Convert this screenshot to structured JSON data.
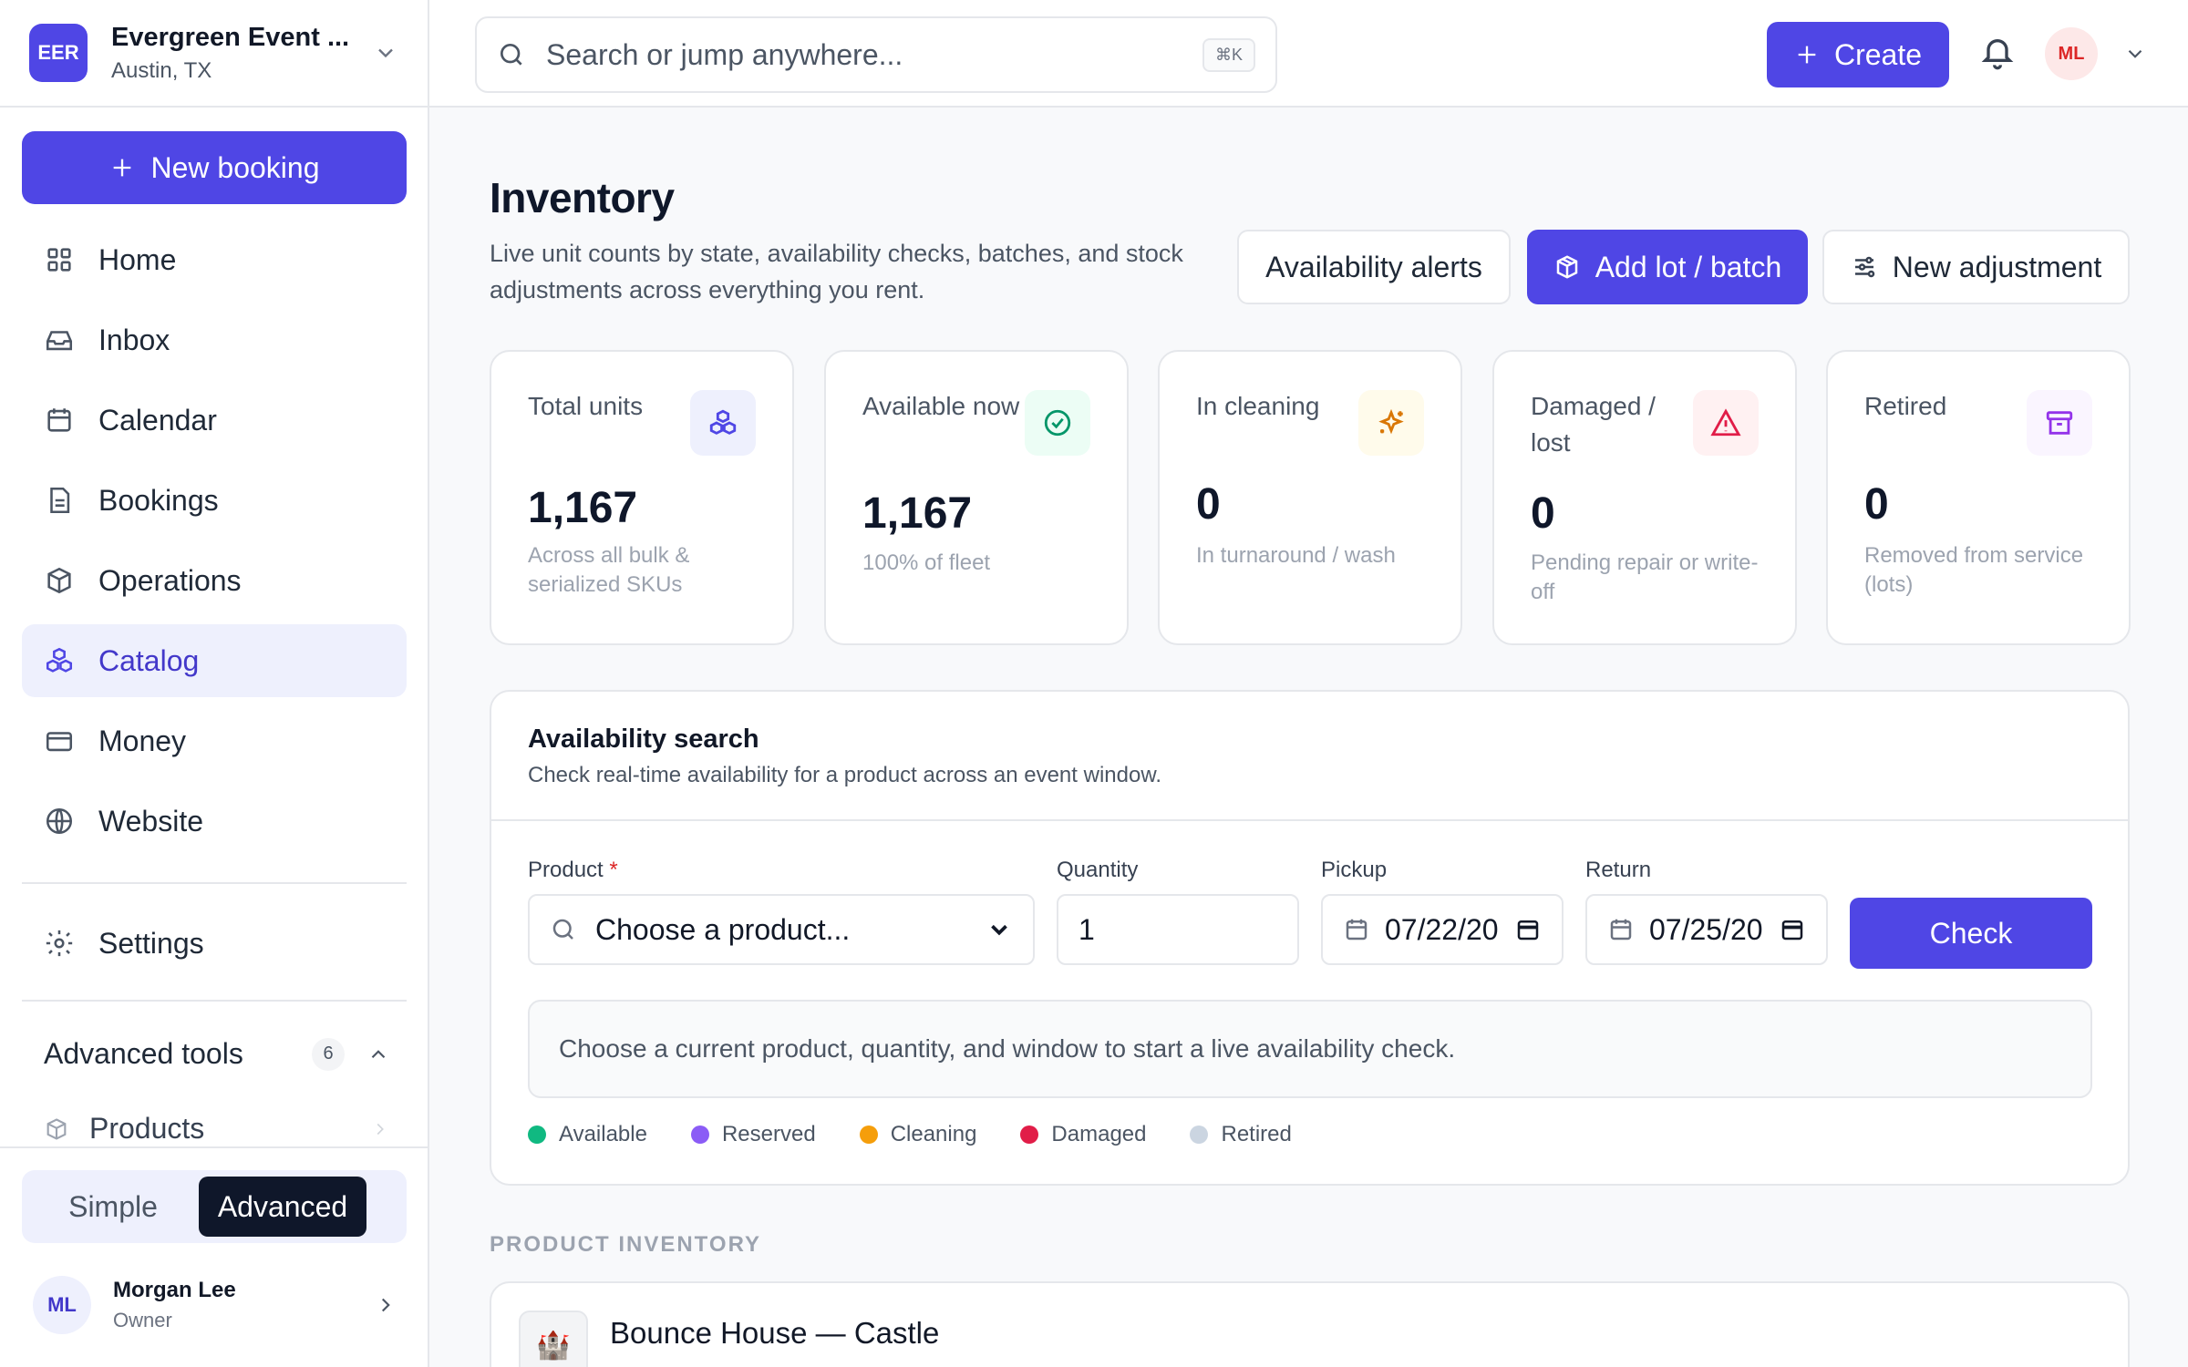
{
  "org": {
    "badge": "EER",
    "name": "Evergreen Event ...",
    "location": "Austin, TX"
  },
  "sidebar": {
    "new_booking": "New booking",
    "items": [
      {
        "label": "Home",
        "icon": "grid-icon"
      },
      {
        "label": "Inbox",
        "icon": "inbox-icon"
      },
      {
        "label": "Calendar",
        "icon": "calendar-icon"
      },
      {
        "label": "Bookings",
        "icon": "document-icon"
      },
      {
        "label": "Operations",
        "icon": "cube-icon"
      },
      {
        "label": "Catalog",
        "icon": "cubes-icon",
        "active": true
      },
      {
        "label": "Money",
        "icon": "card-icon"
      },
      {
        "label": "Website",
        "icon": "globe-icon"
      }
    ],
    "settings": "Settings",
    "advanced_tools": {
      "label": "Advanced tools",
      "count": "6"
    },
    "products": "Products",
    "mode": {
      "simple": "Simple",
      "advanced": "Advanced"
    },
    "user": {
      "initials": "ML",
      "name": "Morgan Lee",
      "role": "Owner"
    }
  },
  "topbar": {
    "search_placeholder": "Search or jump anywhere...",
    "shortcut": "⌘K",
    "create": "Create",
    "avatar": "ML"
  },
  "page": {
    "title": "Inventory",
    "subtitle": "Live unit counts by state, availability checks, batches, and stock adjustments across everything you rent.",
    "buttons": {
      "alerts": "Availability alerts",
      "add_lot": "Add lot / batch",
      "adjustment": "New adjustment"
    }
  },
  "stats": [
    {
      "label": "Total units",
      "value": "1,167",
      "note": "Across all bulk & serialized SKUs",
      "color": "#4f46e5"
    },
    {
      "label": "Available now",
      "value": "1,167",
      "note": "100% of fleet",
      "color": "#059669"
    },
    {
      "label": "In cleaning",
      "value": "0",
      "note": "In turnaround / wash",
      "color": "#d97706"
    },
    {
      "label": "Damaged / lost",
      "value": "0",
      "note": "Pending repair or write-off",
      "color": "#e11d48"
    },
    {
      "label": "Retired",
      "value": "0",
      "note": "Removed from service (lots)",
      "color": "#9333ea"
    }
  ],
  "availability": {
    "title": "Availability search",
    "subtitle": "Check real-time availability for a product across an event window.",
    "product_label": "Product",
    "required": "*",
    "product_placeholder": "Choose a product...",
    "quantity_label": "Quantity",
    "quantity": "1",
    "pickup_label": "Pickup",
    "pickup": "07/22/20",
    "return_label": "Return",
    "return": "07/25/20",
    "check": "Check",
    "message": "Choose a current product, quantity, and window to start a live availability check.",
    "legend": [
      {
        "label": "Available",
        "color": "#10b981"
      },
      {
        "label": "Reserved",
        "color": "#8b5cf6"
      },
      {
        "label": "Cleaning",
        "color": "#f59e0b"
      },
      {
        "label": "Damaged",
        "color": "#e11d48"
      },
      {
        "label": "Retired",
        "color": "#cbd5e1"
      }
    ]
  },
  "product_inventory": {
    "section": "PRODUCT INVENTORY",
    "first_item": {
      "icon": "🏰",
      "name": "Bounce House — Castle"
    }
  }
}
